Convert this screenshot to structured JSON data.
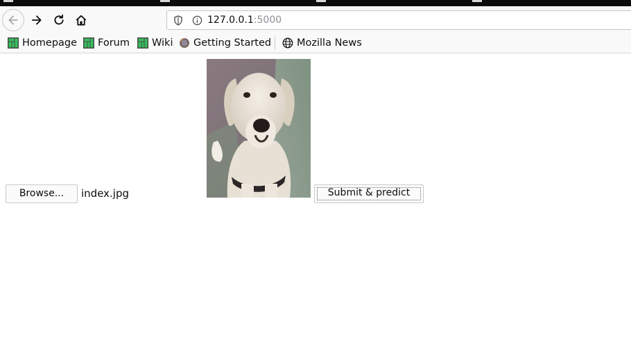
{
  "browser": {
    "url_host": "127.0.0.1",
    "url_port": ":5000",
    "bookmarks": [
      {
        "label": "Homepage",
        "icon": "manjaro-icon"
      },
      {
        "label": "Forum",
        "icon": "manjaro-icon"
      },
      {
        "label": "Wiki",
        "icon": "manjaro-icon"
      },
      {
        "label": "Getting Started",
        "icon": "firefox-icon"
      },
      {
        "label": "Mozilla News",
        "icon": "globe-icon"
      }
    ]
  },
  "form": {
    "browse_label": "Browse...",
    "file_name": "index.jpg",
    "submit_label": "Submit & predict"
  },
  "colors": {
    "toolbar_bg": "#f9f9fa",
    "manjaro_green": "#35bf5c"
  }
}
